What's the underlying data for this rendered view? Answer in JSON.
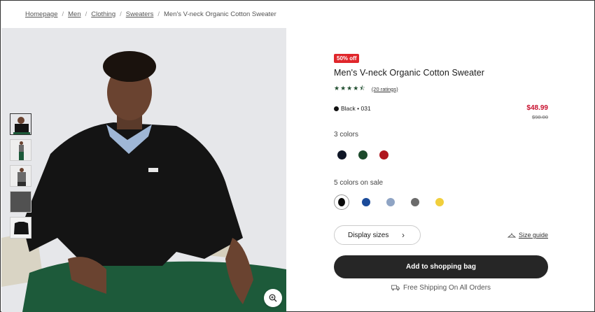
{
  "breadcrumb": {
    "items": [
      "Homepage",
      "Men",
      "Clothing",
      "Sweaters"
    ],
    "current": "Men's V-neck Organic Cotton Sweater"
  },
  "product": {
    "badge": "50% off",
    "title": "Men's V-neck Organic Cotton Sweater",
    "rating_text": "(20 ratings)",
    "rating_value": 4.5,
    "variant": "Black • 031",
    "price": "$48.99",
    "old_price": "$98.00"
  },
  "colors": {
    "label": "3 colors",
    "swatches": [
      "#0f1626",
      "#1d4a2c",
      "#b0161e"
    ]
  },
  "sale_colors": {
    "label": "5 colors on sale",
    "swatches": [
      "#0a0a0a",
      "#1b4b9a",
      "#8fa4c4",
      "#6b6b6b",
      "#f1cf3c"
    ],
    "selected_index": 0
  },
  "actions": {
    "display_sizes": "Display sizes",
    "size_guide": "Size guide",
    "add_to_bag": "Add to shopping bag",
    "shipping": "Free Shipping On All Orders"
  },
  "icons": {
    "zoom": "zoom-in-icon",
    "chevron": "chevron-right-icon",
    "hanger": "hanger-icon",
    "truck": "truck-icon"
  }
}
